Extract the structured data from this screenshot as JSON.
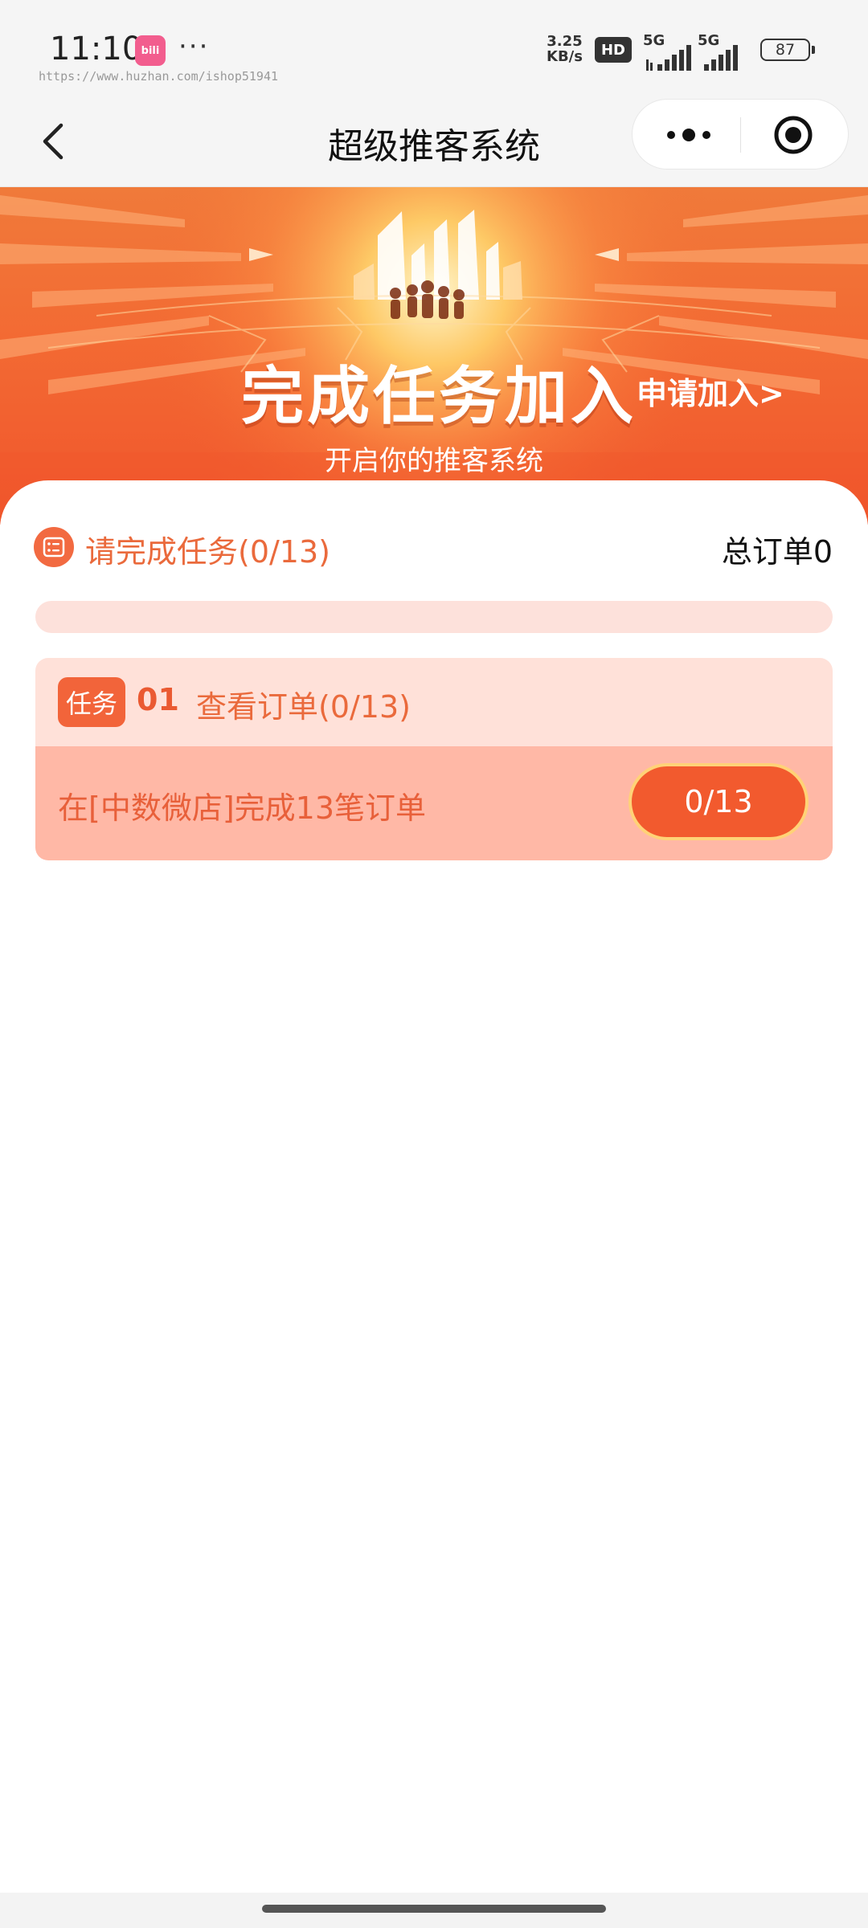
{
  "status_bar": {
    "time": "11:10",
    "app_badge": "bili",
    "more": "···",
    "url_watermark": "https://www.huzhan.com/ishop51941",
    "net_speed_value": "3.25",
    "net_speed_unit": "KB/s",
    "hd": "HD",
    "signal1_label": "5G",
    "signal2_label": "5G",
    "battery": "87"
  },
  "nav": {
    "title": "超级推客系统"
  },
  "banner": {
    "title": "完成任务加入",
    "apply_link": "申请加入>",
    "subtitle": "开启你的推客系统"
  },
  "task_section": {
    "header_label": "请完成任务(0/13)",
    "total_orders": "总订单0",
    "progress": 0
  },
  "tasks": [
    {
      "tag": "任务",
      "number": "01",
      "name": "查看订单(0/13)",
      "description": "在[中数微店]完成13笔订单",
      "button_label": "0/13"
    }
  ],
  "colors": {
    "accent": "#f26a41",
    "banner_top": "#f07a3a",
    "banner_bottom": "#f0552c",
    "task_top_bg": "#ffe1d9",
    "task_bottom_bg": "#ffb8a6",
    "button_border": "#ffd277"
  },
  "icons": {
    "back": "chevron-left-icon",
    "more": "more-dots-icon",
    "close": "target-circle-icon",
    "task_list": "checklist-icon"
  }
}
